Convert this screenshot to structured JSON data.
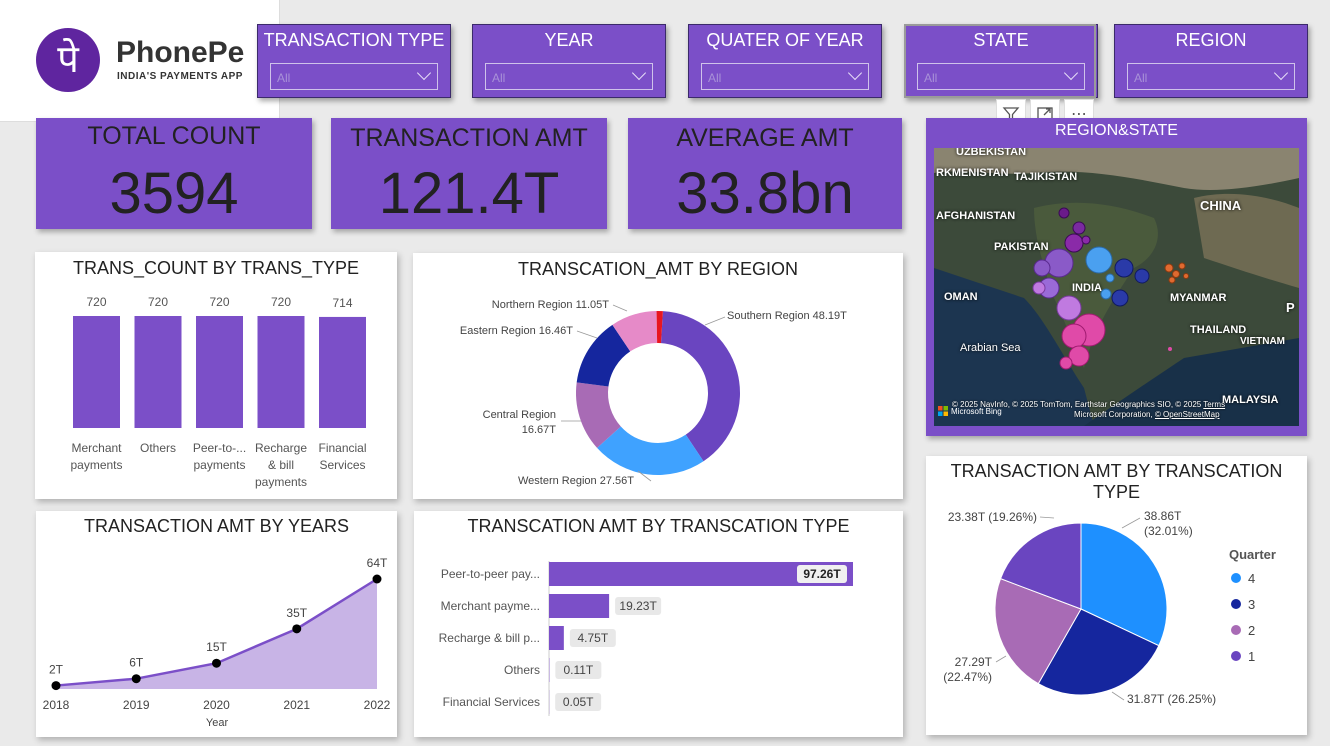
{
  "logo": {
    "glyph": "पे",
    "name": "PhonePe",
    "tagline": "INDIA'S PAYMENTS APP"
  },
  "slicers": [
    {
      "title": "TRANSACTION TYPE",
      "value": "All"
    },
    {
      "title": "YEAR",
      "value": "All"
    },
    {
      "title": "QUATER OF YEAR",
      "value": "All"
    },
    {
      "title": "STATE",
      "value": "All"
    },
    {
      "title": "REGION",
      "value": "All"
    }
  ],
  "toolbar": {
    "filter_icon": "filter-icon",
    "focus_icon": "focus-mode-icon",
    "more_label": "⋯"
  },
  "kpis": [
    {
      "title": "TOTAL COUNT",
      "value": "3594"
    },
    {
      "title": "TRANSACTION AMT",
      "value": "121.4T"
    },
    {
      "title": "AVERAGE AMT",
      "value": "33.8bn"
    }
  ],
  "map": {
    "title": "REGION&STATE",
    "labels": [
      "UZBEKISTAN",
      "RKMENISTAN",
      "TAJIKISTAN",
      "AFGHANISTAN",
      "PAKISTAN",
      "CHINA",
      "INDIA",
      "OMAN",
      "MYANMAR",
      "THAILAND",
      "VIETNAM",
      "Arabian Sea",
      "MALAYSIA",
      "P"
    ],
    "attribution_1": "© 2025 NavInfo, © 2025 TomTom, Earthstar Geographics SIO, © 2025",
    "terms": "Terms",
    "attribution_2": "Microsoft Corporation,",
    "osm": "© OpenStreetMap",
    "bing": "Microsoft Bing"
  },
  "colors": {
    "accent": "#7b4fc8",
    "southern": "#6a45c0",
    "western": "#3fa2ff",
    "central": "#a86bb5",
    "eastern": "#15269e",
    "northern": "#e68ac8",
    "other": "#e8161f"
  },
  "chart_data": [
    {
      "id": "count_by_type",
      "type": "bar",
      "title": "TRANS_COUNT BY TRANS_TYPE",
      "categories": [
        "Merchant payments",
        "Others",
        "Peer-to-... payments",
        "Recharge & bill payments",
        "Financial Services"
      ],
      "category_lines": [
        [
          "Merchant",
          "payments"
        ],
        [
          "Others"
        ],
        [
          "Peer-to-...",
          "payments"
        ],
        [
          "Recharge",
          "& bill",
          "payments"
        ],
        [
          "Financial",
          "Services"
        ]
      ],
      "values": [
        720,
        720,
        720,
        720,
        714
      ],
      "ylim": [
        0,
        720
      ]
    },
    {
      "id": "amt_by_region",
      "type": "pie",
      "subtype": "donut",
      "title": "TRANSCATION_AMT BY REGION",
      "series": [
        {
          "label": "Southern Region",
          "value": 48.19,
          "display": "48.19T"
        },
        {
          "label": "Western Region",
          "value": 27.56,
          "display": "27.56T"
        },
        {
          "label": "Central Region",
          "value": 16.67,
          "display": "16.67T"
        },
        {
          "label": "Eastern Region",
          "value": 16.46,
          "display": "16.46T"
        },
        {
          "label": "Northern Region",
          "value": 11.05,
          "display": "11.05T"
        },
        {
          "label": "",
          "value": 1.5,
          "display": ""
        }
      ]
    },
    {
      "id": "amt_by_years",
      "type": "area",
      "title": "TRANSACTION AMT BY YEARS",
      "xlabel": "Year",
      "x": [
        "2018",
        "2019",
        "2020",
        "2021",
        "2022"
      ],
      "values": [
        2,
        6,
        15,
        35,
        64
      ],
      "data_labels": [
        "2T",
        "6T",
        "15T",
        "35T",
        "64T"
      ],
      "ylim": [
        0,
        64
      ]
    },
    {
      "id": "amt_by_type_bar",
      "type": "bar",
      "orientation": "horizontal",
      "title": "TRANSCATION AMT BY TRANSCATION TYPE",
      "categories": [
        "Peer-to-peer pay...",
        "Merchant payme...",
        "Recharge & bill p...",
        "Others",
        "Financial Services"
      ],
      "values": [
        97.26,
        19.23,
        4.75,
        0.11,
        0.05
      ],
      "data_labels": [
        "97.26T",
        "19.23T",
        "4.75T",
        "0.11T",
        "0.05T"
      ],
      "xlim": [
        0,
        97.26
      ]
    },
    {
      "id": "amt_by_quarter",
      "type": "pie",
      "title": "TRANSACTION AMT BY TRANSCATION TYPE",
      "legend_title": "Quarter",
      "legend_position": "right",
      "series": [
        {
          "name": "4",
          "value": 38.86,
          "label": [
            "38.86T",
            "(32.01%)"
          ]
        },
        {
          "name": "3",
          "value": 31.87,
          "label": [
            "31.87T (26.25%)"
          ]
        },
        {
          "name": "2",
          "value": 27.29,
          "label": [
            "27.29T",
            "(22.47%)"
          ]
        },
        {
          "name": "1",
          "value": 23.38,
          "label": [
            "23.38T (19.26%)"
          ]
        }
      ],
      "legend_order": [
        "4",
        "3",
        "2",
        "1"
      ],
      "colors": {
        "4": "#1e90ff",
        "3": "#15269e",
        "2": "#a86bb5",
        "1": "#6a45c0"
      }
    }
  ]
}
